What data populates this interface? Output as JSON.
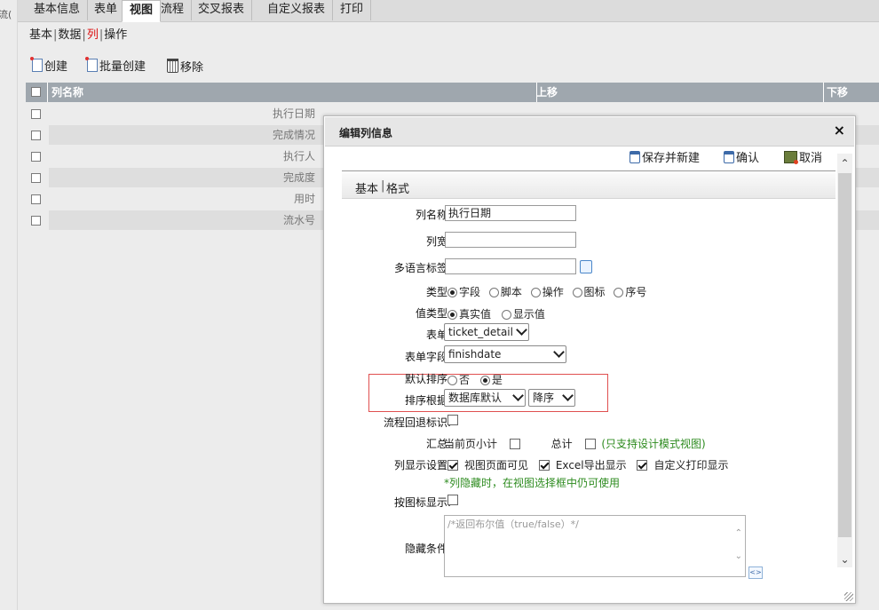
{
  "left_strip_text": "流(",
  "top_tabs": [
    "基本信息",
    "表单",
    "视图",
    "流程",
    "交叉报表",
    "自定义报表",
    "打印"
  ],
  "active_top_tab": "视图",
  "sub_tabs": [
    "基本",
    "数据",
    "列",
    "操作"
  ],
  "active_sub_tab": "列",
  "toolbar": {
    "create": "创建",
    "batch_create": "批量创建",
    "remove": "移除"
  },
  "grid": {
    "headers": {
      "name": "列名称",
      "up": "上移",
      "down": "下移"
    },
    "rows": [
      "执行日期",
      "完成情况",
      "执行人",
      "完成度",
      "用时",
      "流水号"
    ]
  },
  "dialog": {
    "title": "编辑列信息",
    "close": "×",
    "actions": {
      "save_new": "保存并新建",
      "confirm": "确认",
      "cancel": "取消"
    },
    "tabs": [
      "基本",
      "格式"
    ],
    "form": {
      "col_name_label": "列名称:",
      "col_name_value": "执行日期",
      "col_width_label": "列宽:",
      "col_width_value": "",
      "ml_label_label": "多语言标签:",
      "ml_label_value": "",
      "type_label": "类型:",
      "type_options": [
        "字段",
        "脚本",
        "操作",
        "图标",
        "序号"
      ],
      "type_selected": "字段",
      "value_type_label": "值类型:",
      "value_type_options": [
        "真实值",
        "显示值"
      ],
      "value_type_selected": "真实值",
      "form_label": "表单:",
      "form_value": "ticket_detail",
      "form_field_label": "表单字段:",
      "form_field_value": "finishdate",
      "default_sort_label": "默认排序:",
      "default_sort_options": [
        "否",
        "是"
      ],
      "default_sort_selected": "是",
      "sort_by_label": "排序根据:",
      "sort_by_value": "数据库默认",
      "sort_dir_value": "降序",
      "flow_back_label": "流程回退标识:",
      "summary_label": "汇总:",
      "page_subtotal": "当前页小计",
      "total": "总计",
      "summary_note": "(只支持设计模式视图)",
      "display_label": "列显示设置:",
      "display_options": [
        "视图页面可见",
        "Excel导出显示",
        "自定义打印显示"
      ],
      "display_note": "*列隐藏时，在视图选择框中仍可使用",
      "icon_display_label": "按图标显示:",
      "hide_cond_label": "隐藏条件:",
      "hide_cond_placeholder": "/*返回布尔值（true/false）*/"
    }
  }
}
